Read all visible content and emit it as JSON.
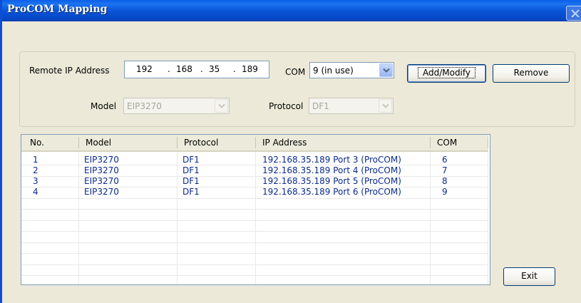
{
  "window": {
    "title": "ProCOM Mapping"
  },
  "form": {
    "remote_ip_label": "Remote IP Address",
    "ip_octets": [
      "192",
      "168",
      "35",
      "189"
    ],
    "com_label": "COM",
    "com_value": "9 (in use)",
    "model_label": "Model",
    "model_value": "EIP3270",
    "protocol_label": "Protocol",
    "protocol_value": "DF1",
    "add_modify_label": "Add/Modify",
    "remove_label": "Remove",
    "exit_label": "Exit"
  },
  "table": {
    "columns": [
      "No.",
      "Model",
      "Protocol",
      "IP Address",
      "COM"
    ],
    "rows": [
      [
        "1",
        "EIP3270",
        "DF1",
        "192.168.35.189 Port 3 (ProCOM)",
        "6"
      ],
      [
        "2",
        "EIP3270",
        "DF1",
        "192.168.35.189 Port 4 (ProCOM)",
        "7"
      ],
      [
        "3",
        "EIP3270",
        "DF1",
        "192.168.35.189 Port 5 (ProCOM)",
        "8"
      ],
      [
        "4",
        "EIP3270",
        "DF1",
        "192.168.35.189 Port 6 (ProCOM)",
        "9"
      ]
    ]
  },
  "colors": {
    "title_bar": "#0b55d9",
    "row_text": "#0a2a8c",
    "dialog_bg": "#ece9d8"
  },
  "icons": {
    "close": "close-icon",
    "dropdown": "chevron-down-icon"
  }
}
